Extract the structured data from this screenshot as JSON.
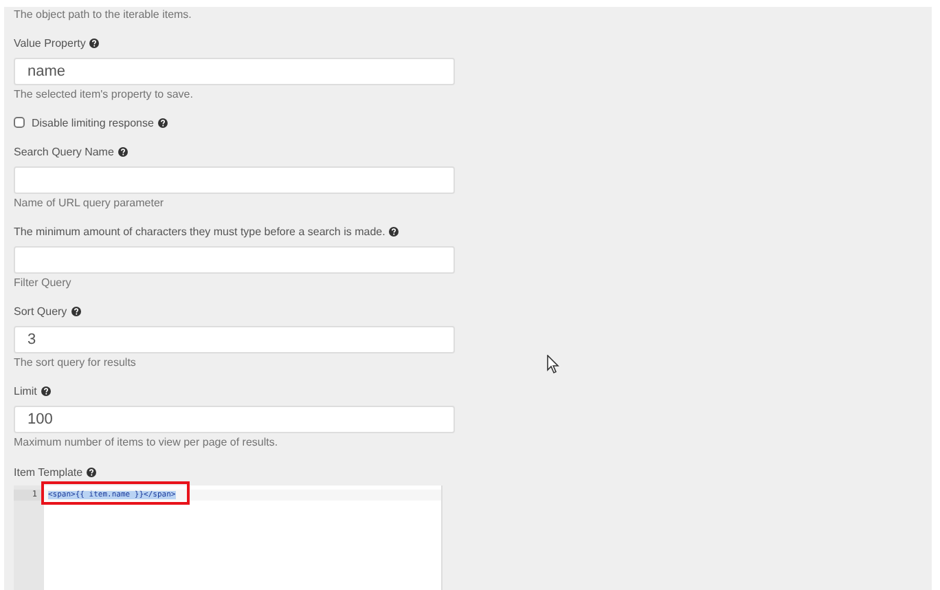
{
  "intro_help": "The object path to the iterable items.",
  "fields": [
    {
      "kind": "input",
      "label": "Value Property",
      "value": "name",
      "help": "The selected item's property to save."
    },
    {
      "kind": "checkbox",
      "label": "Disable limiting response",
      "checked": false
    },
    {
      "kind": "input",
      "label": "Search Query Name",
      "help": "Name of URL query parameter"
    },
    {
      "kind": "input",
      "label": "The minimum amount of characters they must type before a search is made.",
      "help": "Filter Query"
    },
    {
      "kind": "input",
      "label": "Sort Query",
      "value": "3",
      "help": "The sort query for results"
    },
    {
      "kind": "input",
      "label": "Limit",
      "value": "100",
      "help": "Maximum number of items to view per page of results."
    }
  ],
  "template": {
    "label": "Item Template",
    "lines": [
      {
        "number": "1",
        "code": "<span>{{ item.name }}</span>",
        "selected": true
      }
    ]
  }
}
